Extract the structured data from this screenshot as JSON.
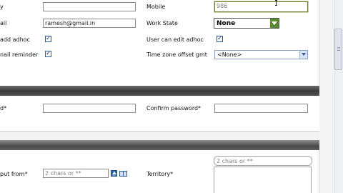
{
  "row1": {
    "left_label": "y",
    "left_value": "",
    "right_label": "Mobile",
    "right_value": "986"
  },
  "row2": {
    "left_label": "ail",
    "left_value": "ramesh@gmail.in",
    "right_label": "Work State",
    "right_value": "None"
  },
  "row3": {
    "left_label": "add adhoc",
    "left_checked": true,
    "right_label": "User can edit adhoc",
    "right_checked": true
  },
  "row4": {
    "left_label": "nail reminder",
    "left_checked": true,
    "right_label": "Time zone offset gmt",
    "right_value": "<None>"
  },
  "password_section": {
    "left_label": "d*",
    "left_value": "",
    "right_label": "Confirm password*",
    "right_value": ""
  },
  "territory_section": {
    "left_label": "put from*",
    "left_placeholder": "2 chars or **",
    "right_label": "Territory*",
    "right_placeholder": "2 chars or **"
  },
  "checkmark_glyph": "✓",
  "colors": {
    "section_bar": "#3a3a3a",
    "select_button": "#5a8a2c",
    "focus_border": "#6b7c3a"
  }
}
